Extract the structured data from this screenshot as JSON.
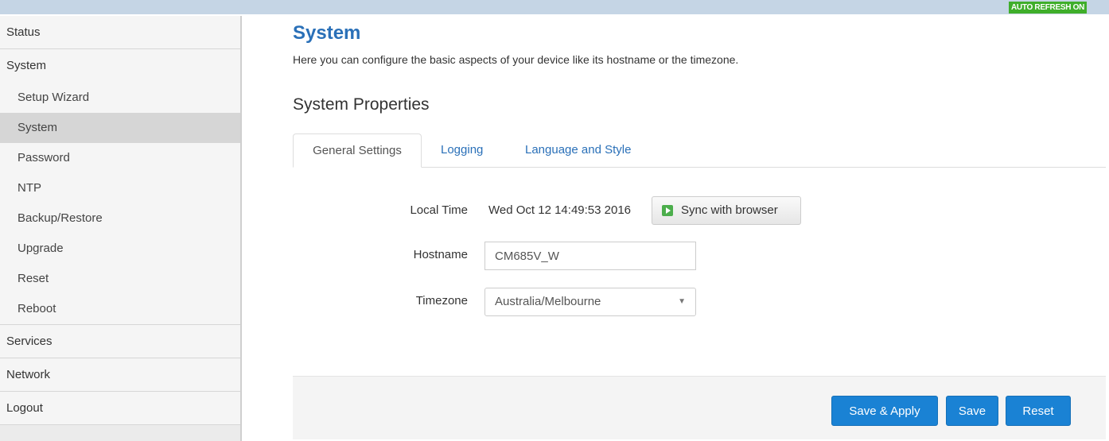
{
  "topbar": {
    "auto_refresh": "AUTO REFRESH ON",
    "badge_color": "#3fae2a"
  },
  "sidebar": {
    "items": [
      {
        "label": "Status"
      },
      {
        "label": "System"
      },
      {
        "label": "Setup Wizard"
      },
      {
        "label": "System",
        "active": true
      },
      {
        "label": "Password"
      },
      {
        "label": "NTP"
      },
      {
        "label": "Backup/Restore"
      },
      {
        "label": "Upgrade"
      },
      {
        "label": "Reset"
      },
      {
        "label": "Reboot"
      },
      {
        "label": "Services"
      },
      {
        "label": "Network"
      },
      {
        "label": "Logout"
      }
    ]
  },
  "page": {
    "title": "System",
    "description": "Here you can configure the basic aspects of your device like its hostname or the timezone.",
    "section_title": "System Properties",
    "tabs": [
      {
        "label": "General Settings",
        "active": true
      },
      {
        "label": "Logging"
      },
      {
        "label": "Language and Style"
      }
    ]
  },
  "form": {
    "local_time_label": "Local Time",
    "local_time_value": "Wed Oct 12 14:49:53 2016",
    "sync_button": "Sync with browser",
    "hostname_label": "Hostname",
    "hostname_value": "CM685V_W",
    "timezone_label": "Timezone",
    "timezone_value": "Australia/Melbourne"
  },
  "actions": {
    "save_apply": "Save & Apply",
    "save": "Save",
    "reset": "Reset"
  },
  "colors": {
    "accent": "#2a70b8",
    "button": "#1a82d4"
  }
}
